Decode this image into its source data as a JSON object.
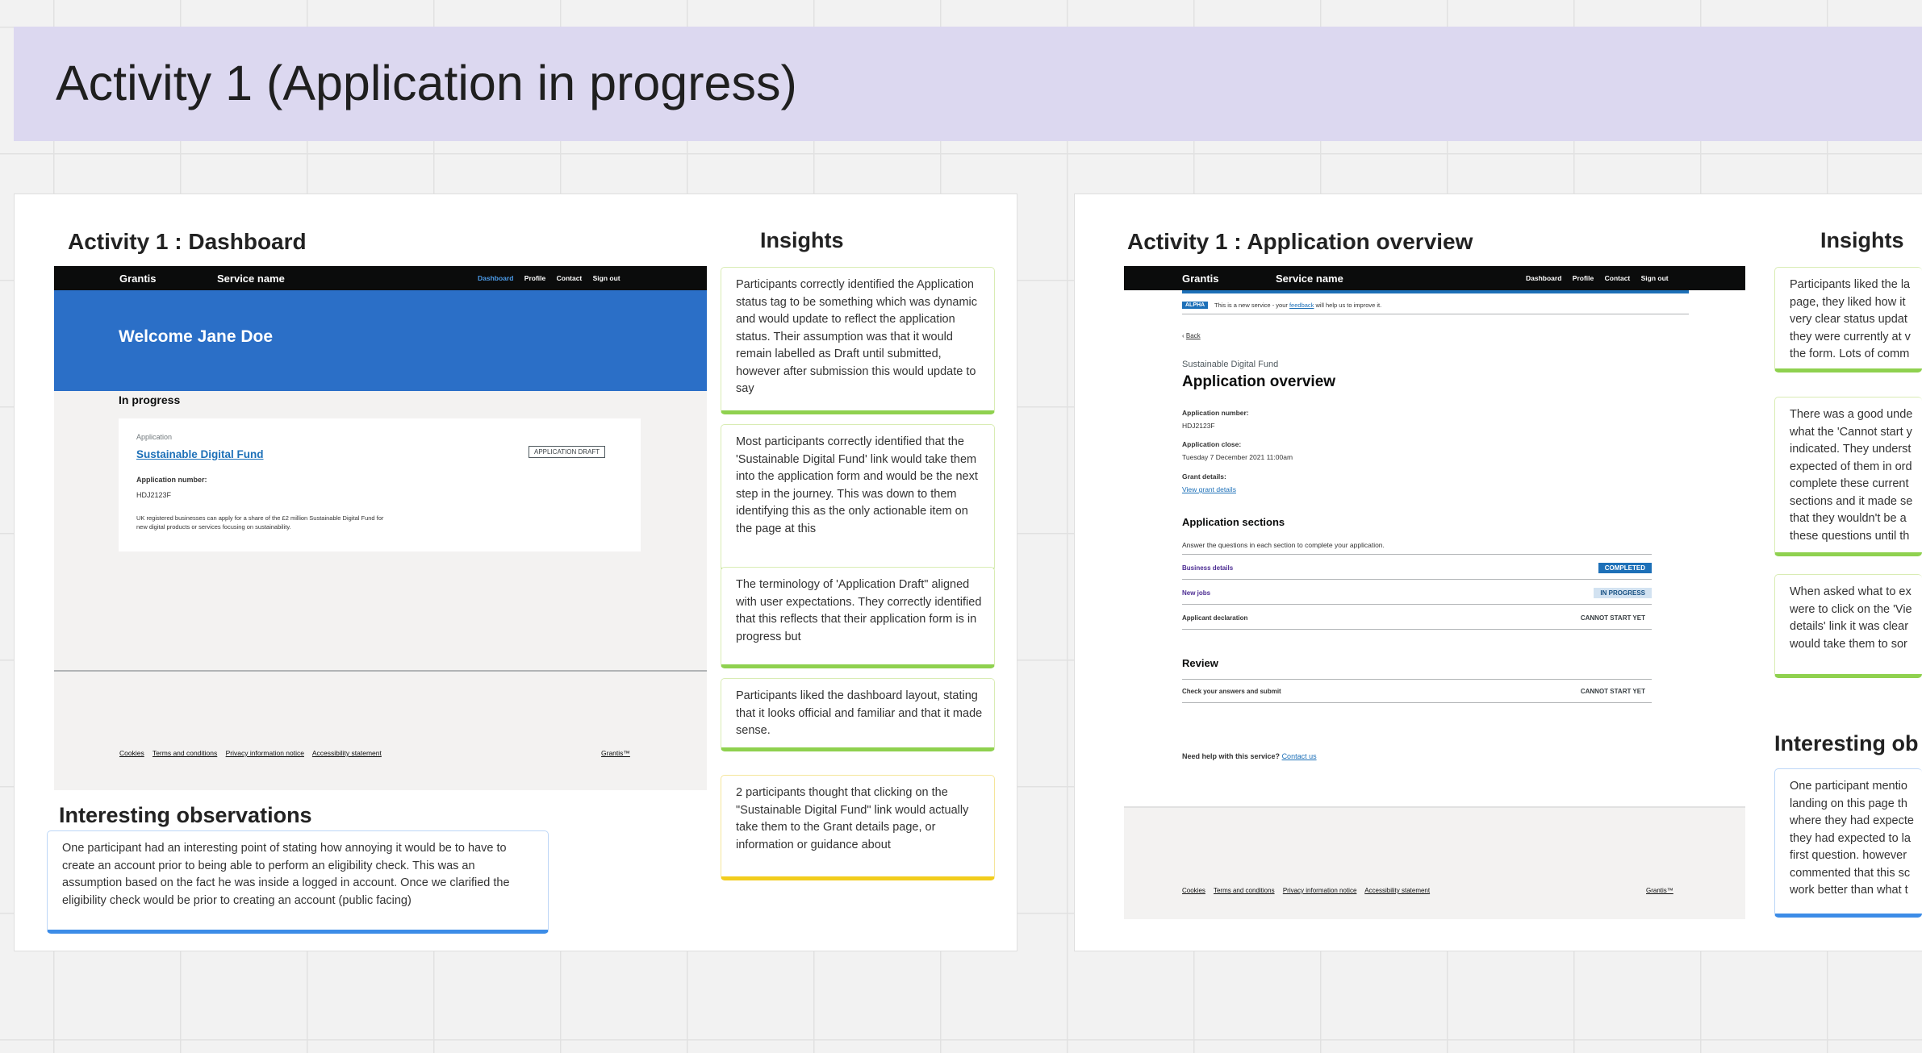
{
  "page_title": "Activity 1 (Application in progress)",
  "left_frame": {
    "title": "Activity 1 : Dashboard",
    "insights_heading": "Insights",
    "screenshot": {
      "brand": "Grantis",
      "service_name": "Service name",
      "nav": [
        "Dashboard",
        "Profile",
        "Contact",
        "Sign out"
      ],
      "welcome": "Welcome Jane Doe",
      "section_heading": "In progress",
      "card_caption": "Application",
      "card_link": "Sustainable Digital Fund",
      "tag": "APPLICATION DRAFT",
      "app_number_label": "Application number:",
      "app_number": "HDJ2123F",
      "description_line1": "UK registered businesses can apply for a share of the £2 million Sustainable Digital Fund for",
      "description_line2": "new digital products or services focusing on sustainability.",
      "footer_links": [
        "Cookies",
        "Terms and conditions",
        "Privacy information notice",
        "Accessibility statement"
      ],
      "footer_brand": "Grantis™"
    },
    "insights": [
      {
        "color": "green",
        "text": "Participants correctly identified the Application status tag to be something which was dynamic and would update to reflect the application status. Their assumption was that it would remain labelled as Draft until submitted, however after submission this would update to say"
      },
      {
        "color": "green",
        "text": "Most participants correctly identified that the 'Sustainable Digital Fund' link would take them into the application form and would be the next step in the journey. This was down to them identifying this as the only actionable item on the page at this"
      },
      {
        "color": "green",
        "text": "The terminology of 'Application Draft\" aligned with user expectations. They correctly identified that this reflects that their application form is in progress but"
      },
      {
        "color": "green",
        "text": "Participants liked the dashboard layout, stating that it looks official and familiar and that it made sense."
      },
      {
        "color": "yellow",
        "text": "2 participants thought that clicking on the \"Sustainable Digital Fund\" link would actually take them to the Grant details page, or information or guidance about"
      }
    ],
    "observations_heading": "Interesting observations",
    "observation": "One participant had an interesting point of stating how annoying it would be to have to create an account prior to being able to perform an eligibility check. This was an assumption based on the fact he was inside a logged in account. Once we clarified the eligibility check would be prior to creating an account (public facing)"
  },
  "right_frame": {
    "title": "Activity 1 : Application overview",
    "insights_heading": "Insights",
    "screenshot": {
      "brand": "Grantis",
      "service_name": "Service name",
      "nav": [
        "Dashboard",
        "Profile",
        "Contact",
        "Sign out"
      ],
      "alpha_tag": "ALPHA",
      "banner_text_pre": "This is a new service - your",
      "banner_link": "feedback",
      "banner_text_post": "will help us to improve it.",
      "back": "Back",
      "caption": "Sustainable Digital Fund",
      "heading": "Application overview",
      "app_number_label": "Application number:",
      "app_number": "HDJ2123F",
      "closes_label": "Application close:",
      "closes_value": "Tuesday 7 December 2021 11:00am",
      "grant_label": "Grant details:",
      "grant_link": "View grant details",
      "sections_heading": "Application sections",
      "sections_hint": "Answer the questions in each section to complete your application.",
      "sections": [
        {
          "name": "Business details",
          "status": "COMPLETED",
          "style": "completed",
          "link": true
        },
        {
          "name": "New jobs",
          "status": "IN PROGRESS",
          "style": "inprogress",
          "link": true
        },
        {
          "name": "Applicant declaration",
          "status": "CANNOT START YET",
          "style": "cannot",
          "link": false
        }
      ],
      "review_heading": "Review",
      "review_row": {
        "name": "Check your answers and submit",
        "status": "CANNOT START YET"
      },
      "help_text": "Need help with this service?",
      "help_link": "Contact us",
      "footer_links": [
        "Cookies",
        "Terms and conditions",
        "Privacy information notice",
        "Accessibility statement"
      ],
      "footer_brand": "Grantis™"
    },
    "insights": [
      {
        "color": "green",
        "text": "Participants liked the la page, they liked how it very clear status updat they were currently at v the form. Lots of comm"
      },
      {
        "color": "green",
        "text": "There was a good unde what the 'Cannot start y indicated. They underst expected of them in ord complete these current sections and it made se that they wouldn't be a these questions until th"
      },
      {
        "color": "green",
        "text": "When asked what to ex were to click on the 'Vie details' link it was clear would take them to sor"
      }
    ],
    "observations_heading": "Interesting ob",
    "observation": "One participant mentio landing on this page th where they had expecte they had expected to la first question. however commented that this sc work better than what t"
  }
}
